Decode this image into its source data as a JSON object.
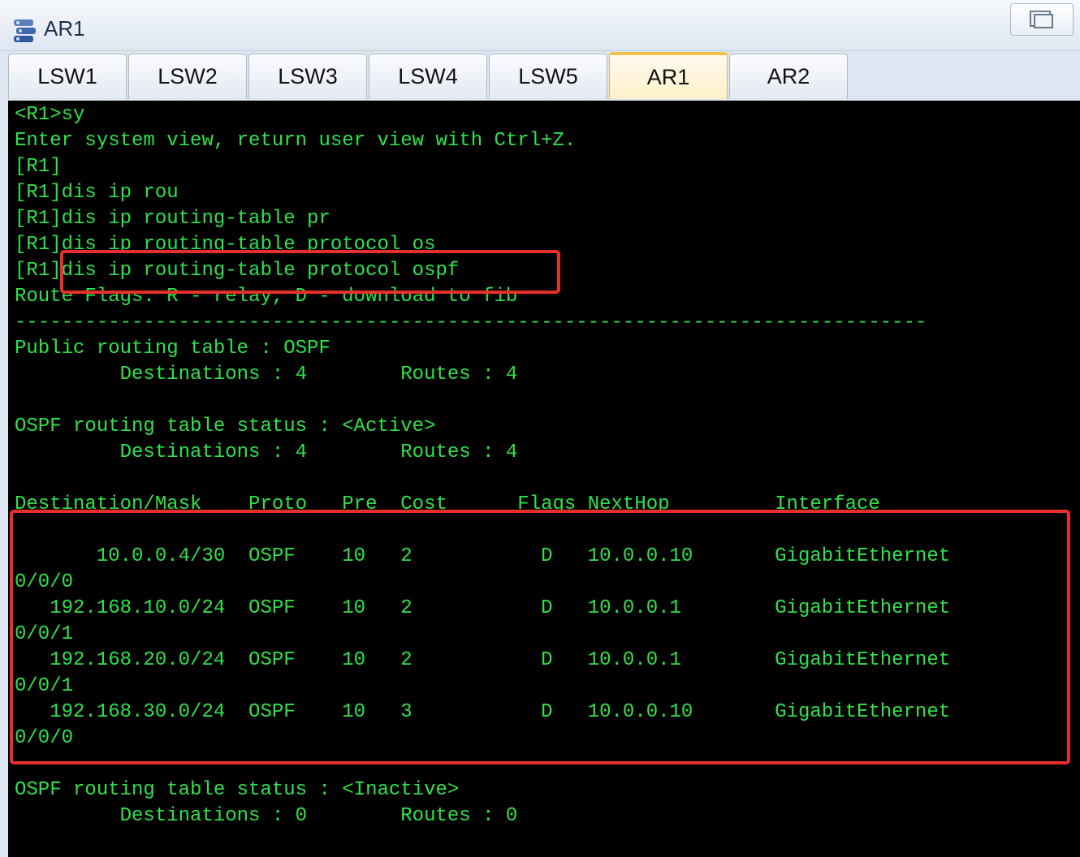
{
  "window": {
    "title": "AR1",
    "icon": "router-app-icon"
  },
  "tabs": [
    {
      "label": "LSW1",
      "active": false
    },
    {
      "label": "LSW2",
      "active": false
    },
    {
      "label": "LSW3",
      "active": false
    },
    {
      "label": "LSW4",
      "active": false
    },
    {
      "label": "LSW5",
      "active": false
    },
    {
      "label": "AR1",
      "active": true
    },
    {
      "label": "AR2",
      "active": false
    }
  ],
  "terminal": {
    "colors": {
      "background": "#000000",
      "text": "#2fe24b",
      "highlight": "#e8302b"
    },
    "lines": [
      "<R1>sy",
      "Enter system view, return user view with Ctrl+Z.",
      "[R1]",
      "[R1]dis ip rou",
      "[R1]dis ip routing-table pr",
      "[R1]dis ip routing-table protocol os",
      "[R1]dis ip routing-table protocol ospf",
      "Route Flags: R - relay, D - download to fib",
      "------------------------------------------------------------------------------",
      "Public routing table : OSPF",
      "         Destinations : 4        Routes : 4",
      "",
      "OSPF routing table status : <Active>",
      "         Destinations : 4        Routes : 4",
      "",
      "Destination/Mask    Proto   Pre  Cost      Flags NextHop         Interface",
      "",
      "       10.0.0.4/30  OSPF    10   2           D   10.0.0.10       GigabitEthernet",
      "0/0/0",
      "   192.168.10.0/24  OSPF    10   2           D   10.0.0.1        GigabitEthernet",
      "0/0/1",
      "   192.168.20.0/24  OSPF    10   2           D   10.0.0.1        GigabitEthernet",
      "0/0/1",
      "   192.168.30.0/24  OSPF    10   3           D   10.0.0.10       GigabitEthernet",
      "0/0/0",
      "",
      "OSPF routing table status : <Inactive>",
      "         Destinations : 0        Routes : 0"
    ]
  }
}
